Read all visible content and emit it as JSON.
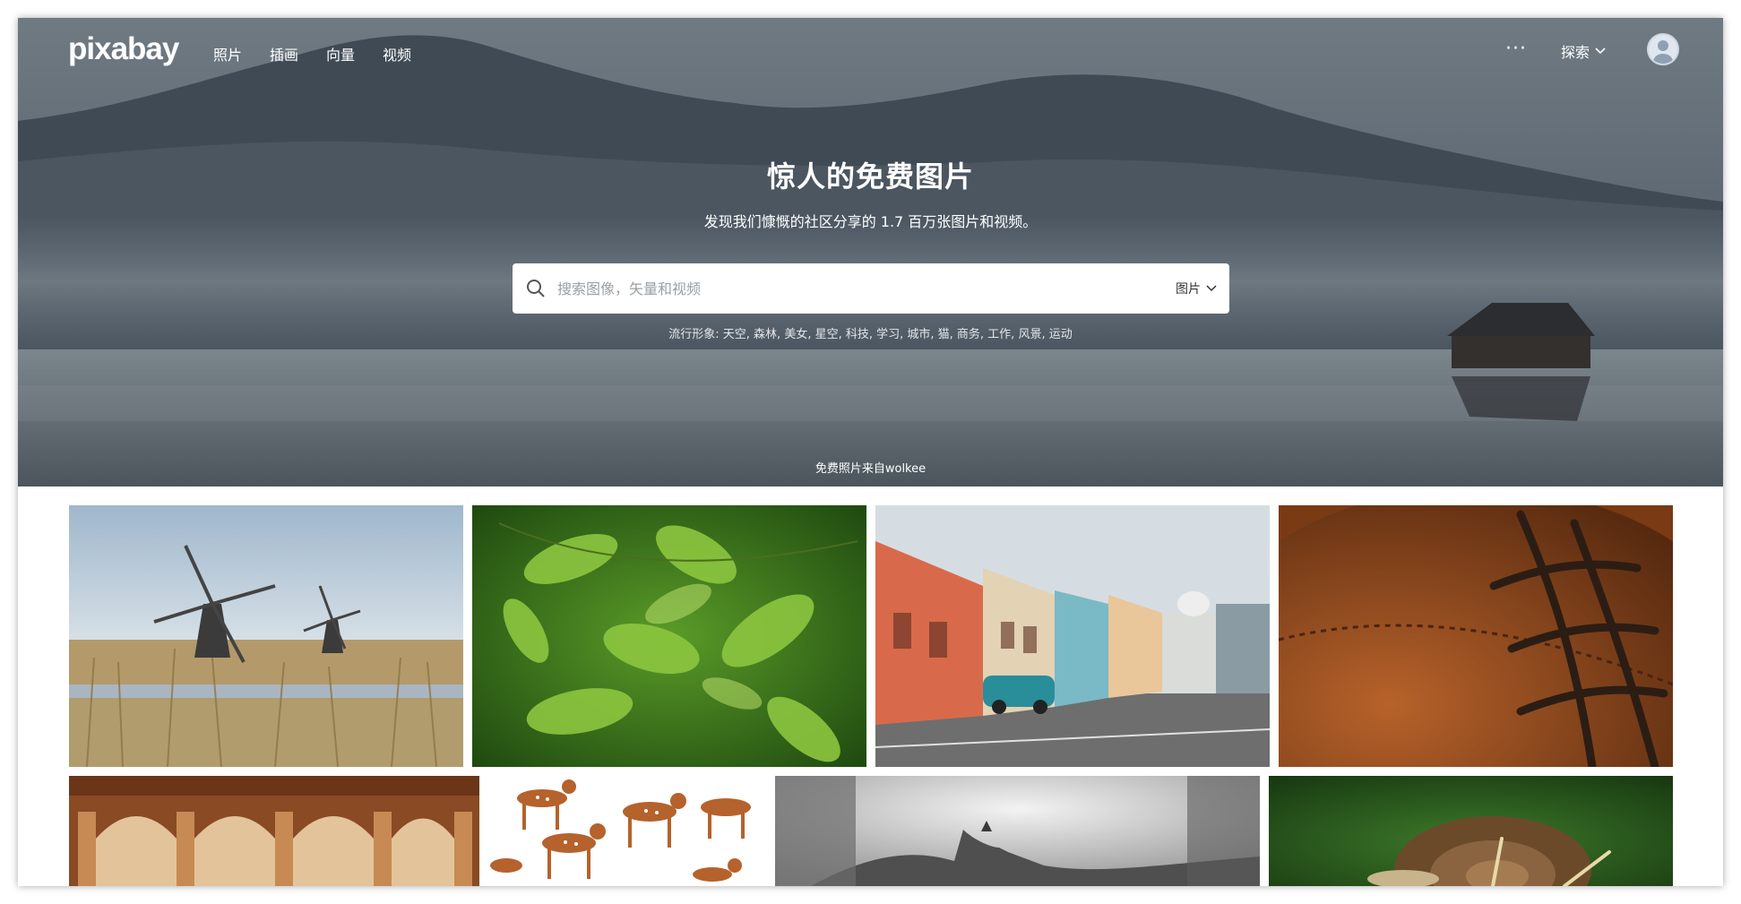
{
  "brand": {
    "logo": "pixabay"
  },
  "nav": {
    "items": [
      "照片",
      "插画",
      "向量",
      "视频"
    ]
  },
  "header": {
    "more": "···",
    "explore": "探索"
  },
  "hero": {
    "title": "惊人的免费图片",
    "subtitle": "发现我们慷慨的社区分享的 1.7 百万张图片和视频。",
    "trending": "流行形象: 天空, 森林, 美女, 星空, 科技, 学习, 城市, 猫, 商务, 工作, 风景, 运动",
    "credit": "免费照片来自wolkee"
  },
  "search": {
    "placeholder": "搜索图像，矢量和视频",
    "type": "图片"
  },
  "icons": {
    "search": "search-icon",
    "chevron": "chevron-down-icon",
    "avatar": "user-avatar-icon",
    "more": "more-icon"
  },
  "colors": {
    "hero_overlay": "#56626d",
    "text": "#ffffff",
    "search_bg": "#ffffff"
  }
}
